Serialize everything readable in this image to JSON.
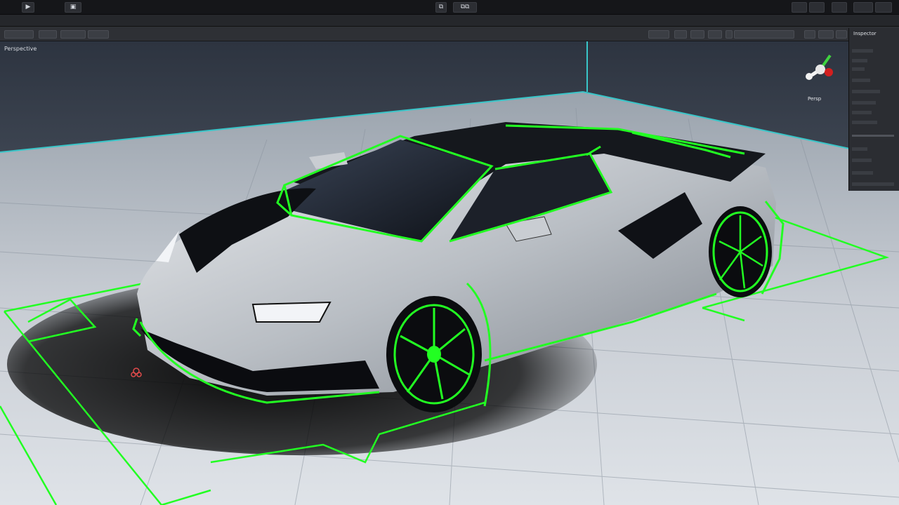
{
  "window": {
    "title_buttons": [
      "▶",
      "▣"
    ],
    "center_buttons": [
      "⧉",
      "⧉⧉"
    ]
  },
  "viewport": {
    "label": "Perspective",
    "gizmo_label": "Persp",
    "background_color": "#c7ccd3",
    "wireframe_color": "#22ff22",
    "grid_color": "#8a939e"
  },
  "inspector": {
    "title": "Inspector"
  },
  "icons": {
    "play": "play-icon",
    "window": "window-icon",
    "gizmo": "axis-gizmo-icon",
    "cursor": "move-cursor-icon"
  }
}
